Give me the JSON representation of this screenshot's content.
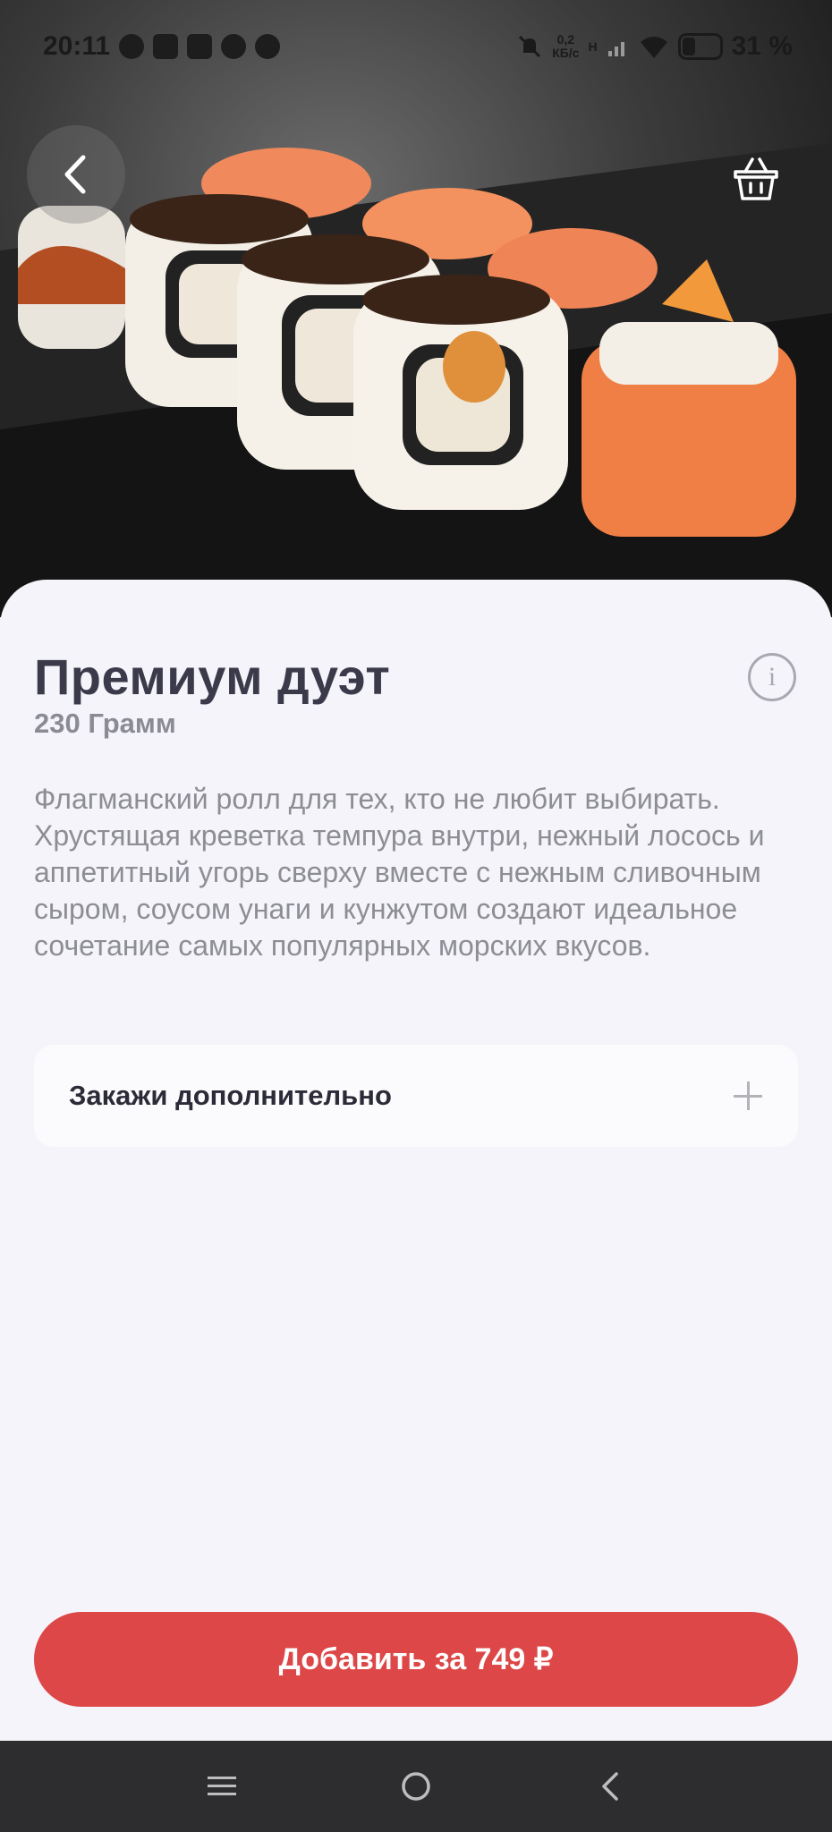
{
  "status_bar": {
    "time": "20:11",
    "net_speed_value": "0,2",
    "net_speed_unit": "КБ/с",
    "network_type": "H",
    "battery": "31 %"
  },
  "product": {
    "title": "Премиум дуэт",
    "weight": "230 Грамм",
    "description": "Флагманский ролл для тех, кто не любит выбирать. Хрустящая креветка темпура внутри, нежный лосось и аппетитный угорь сверху вместе с нежным сливочным сыром, соусом унаги и кунжутом создают идеальное сочетание самых популярных морских вкусов."
  },
  "extras": {
    "label": "Закажи дополнительно"
  },
  "add_button": {
    "label": "Добавить за 749 ₽"
  },
  "colors": {
    "accent": "#dd4747",
    "background": "#f4f4fa",
    "title": "#3b3a4a",
    "muted": "#8d8d94"
  },
  "icons": {
    "back": "chevron-left-icon",
    "cart": "basket-icon",
    "info": "info-icon",
    "expand": "plus-icon",
    "nav_menu": "menu-icon",
    "nav_home": "home-circle-icon",
    "nav_back": "back-triangle-icon"
  }
}
